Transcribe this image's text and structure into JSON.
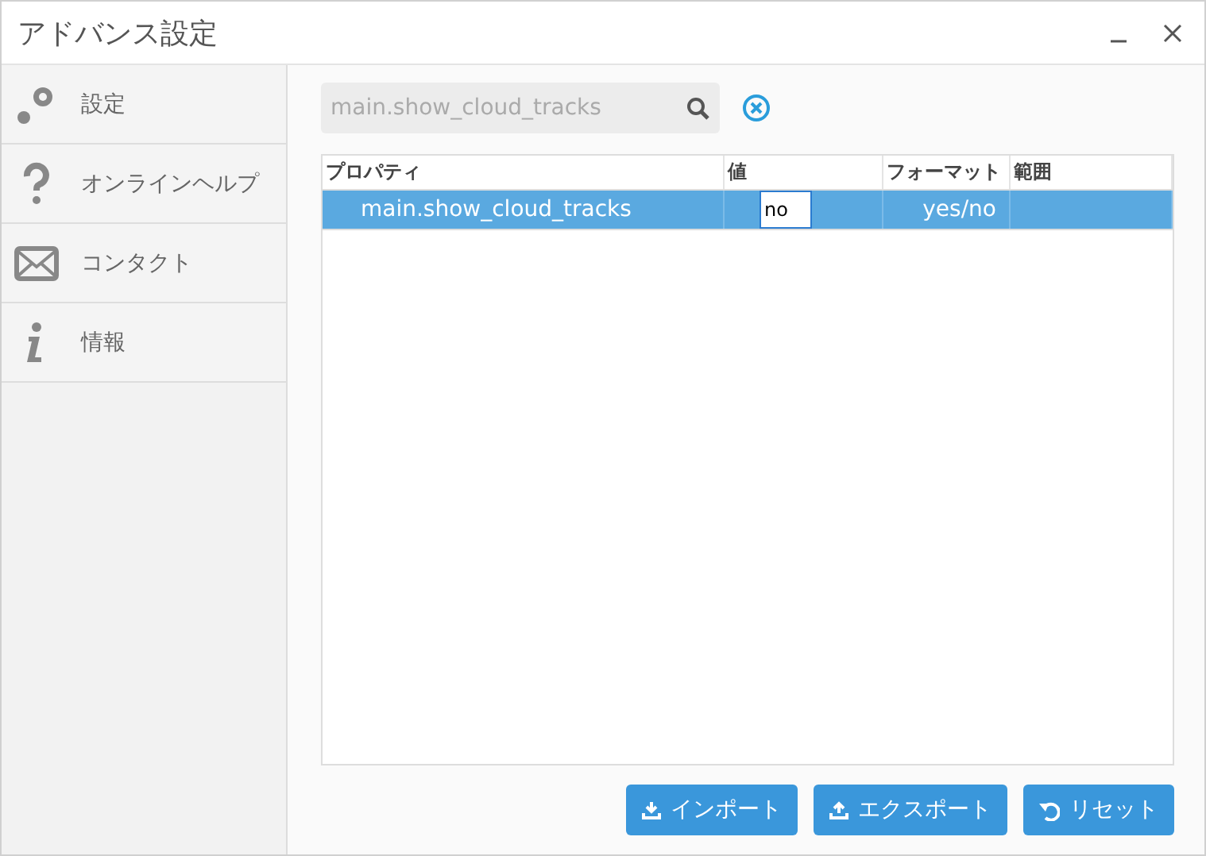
{
  "window": {
    "title": "アドバンス設定"
  },
  "sidebar": {
    "items": [
      {
        "kind": "gear",
        "label": "設定"
      },
      {
        "kind": "help",
        "label": "オンラインヘルプ"
      },
      {
        "kind": "mail",
        "label": "コンタクト"
      },
      {
        "kind": "info",
        "label": "情報"
      }
    ]
  },
  "search": {
    "value": "main.show_cloud_tracks"
  },
  "table": {
    "columns": [
      "プロパティ",
      "値",
      "フォーマット",
      "範囲"
    ],
    "rows": [
      {
        "property": "main.show_cloud_tracks",
        "value": "no",
        "format": "yes/no",
        "selected": true
      }
    ]
  },
  "buttons": [
    {
      "kind": "import",
      "label": "インポート"
    },
    {
      "kind": "export",
      "label": "エクスポート"
    },
    {
      "kind": "reset",
      "label": "リセット"
    }
  ]
}
